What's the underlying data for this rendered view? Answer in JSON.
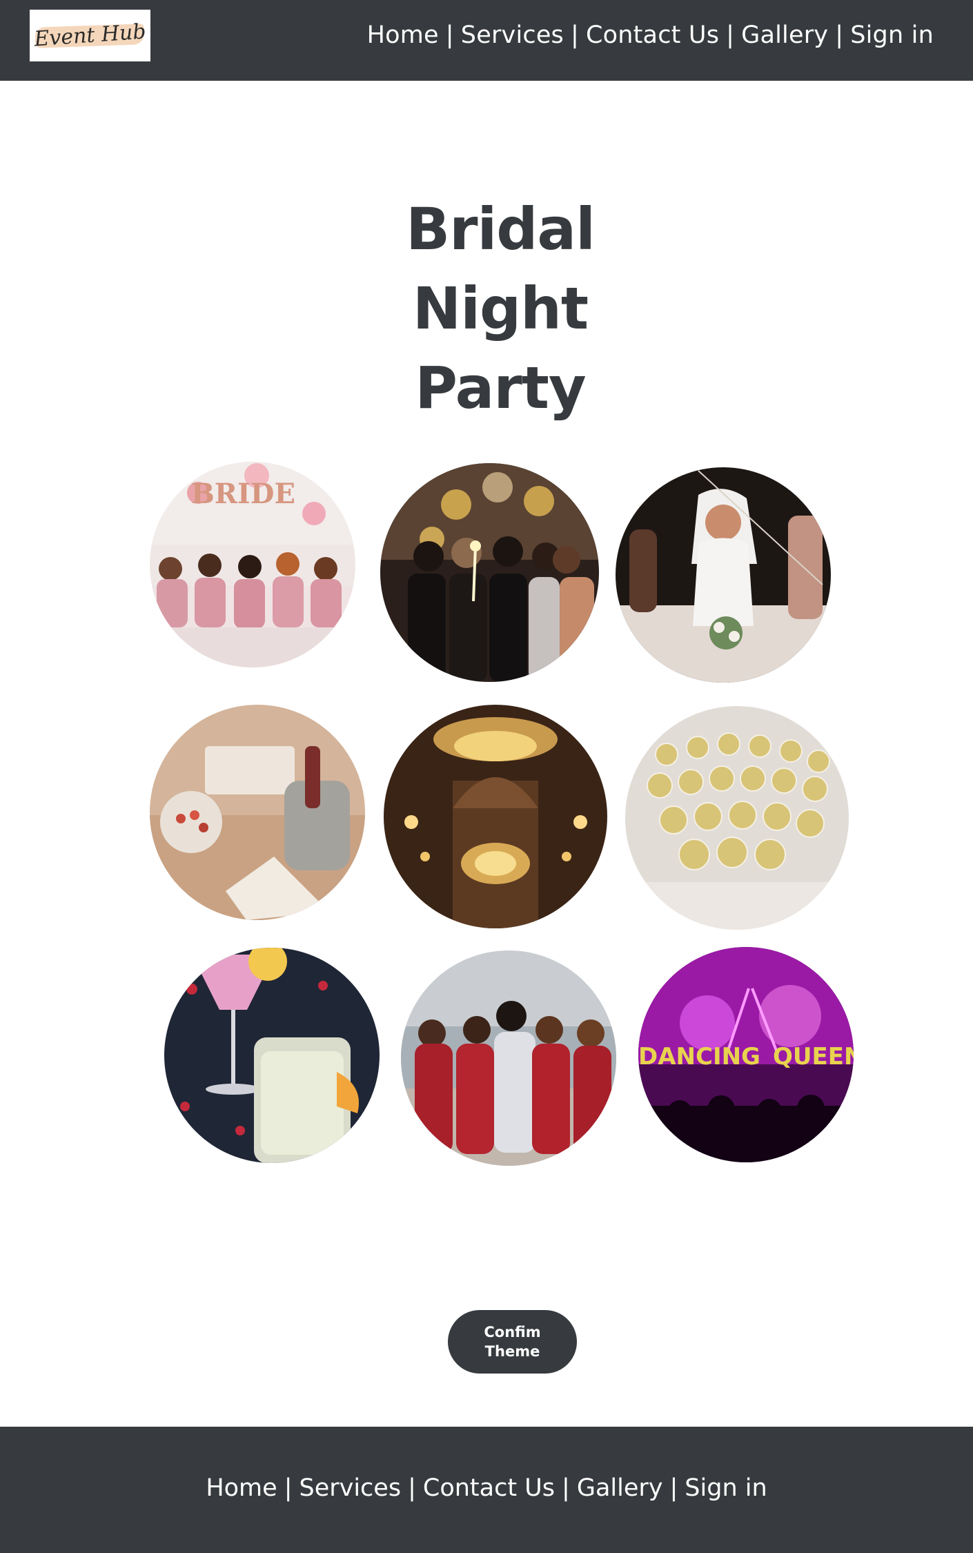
{
  "header": {
    "logo_text": "Event Hub",
    "nav": {
      "home": "Home",
      "services": "Services",
      "contact": "Contact Us",
      "gallery": "Gallery",
      "signin": "Sign in",
      "separator": "|"
    }
  },
  "main": {
    "title_line1": "Bridal Night",
    "title_line2": "Party",
    "confirm_label_line1": "Confim",
    "confirm_label_line2": "Theme"
  },
  "footer": {
    "nav": {
      "home": "Home",
      "services": "Services",
      "contact": "Contact Us",
      "gallery": "Gallery",
      "signin": "Sign in",
      "separator": "|"
    }
  },
  "colors": {
    "header_bg": "#373b3f",
    "text_dark": "#373b3f",
    "text_light": "#ffffff"
  }
}
